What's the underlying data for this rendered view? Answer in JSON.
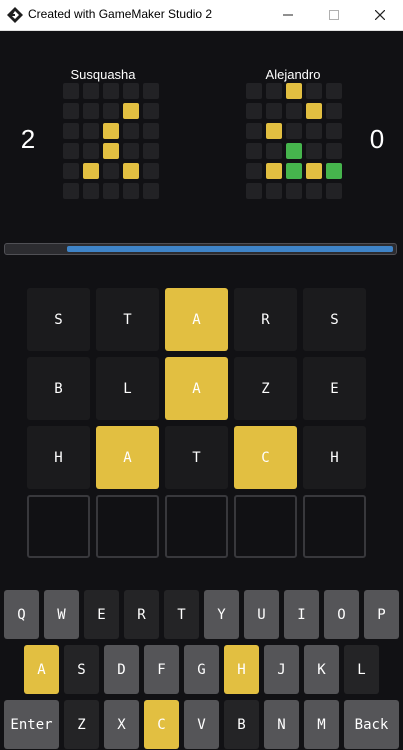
{
  "window": {
    "title": "Created with GameMaker Studio 2"
  },
  "colors": {
    "yellow": "#e2bf41",
    "green": "#46b54d",
    "tile_dark": "#1b1b1d",
    "key_default": "#555558",
    "key_absent": "#242426",
    "mini_empty": "#222225",
    "progress": "#3f84c8"
  },
  "players": [
    {
      "name": "Susquasha",
      "score": "2",
      "grid": [
        [
          "e",
          "e",
          "e",
          "e",
          "e"
        ],
        [
          "e",
          "e",
          "e",
          "y",
          "e"
        ],
        [
          "e",
          "e",
          "y",
          "e",
          "e"
        ],
        [
          "e",
          "e",
          "y",
          "e",
          "e"
        ],
        [
          "e",
          "y",
          "e",
          "y",
          "e"
        ],
        [
          "e",
          "e",
          "e",
          "e",
          "e"
        ]
      ]
    },
    {
      "name": "Alejandro",
      "score": "0",
      "grid": [
        [
          "e",
          "e",
          "y",
          "e",
          "e"
        ],
        [
          "e",
          "e",
          "e",
          "y",
          "e"
        ],
        [
          "e",
          "y",
          "e",
          "e",
          "e"
        ],
        [
          "e",
          "e",
          "g",
          "e",
          "e"
        ],
        [
          "e",
          "y",
          "g",
          "y",
          "g"
        ],
        [
          "e",
          "e",
          "e",
          "e",
          "e"
        ]
      ]
    }
  ],
  "timer": {
    "remaining_fraction": 0.84
  },
  "board": {
    "rows": [
      [
        {
          "letter": "S",
          "state": "absent"
        },
        {
          "letter": "T",
          "state": "absent"
        },
        {
          "letter": "A",
          "state": "present"
        },
        {
          "letter": "R",
          "state": "absent"
        },
        {
          "letter": "S",
          "state": "absent"
        }
      ],
      [
        {
          "letter": "B",
          "state": "absent"
        },
        {
          "letter": "L",
          "state": "absent"
        },
        {
          "letter": "A",
          "state": "present"
        },
        {
          "letter": "Z",
          "state": "absent"
        },
        {
          "letter": "E",
          "state": "absent"
        }
      ],
      [
        {
          "letter": "H",
          "state": "absent"
        },
        {
          "letter": "A",
          "state": "present"
        },
        {
          "letter": "T",
          "state": "absent"
        },
        {
          "letter": "C",
          "state": "present"
        },
        {
          "letter": "H",
          "state": "absent"
        }
      ],
      [
        {
          "letter": "",
          "state": "empty"
        },
        {
          "letter": "",
          "state": "empty"
        },
        {
          "letter": "",
          "state": "empty"
        },
        {
          "letter": "",
          "state": "empty"
        },
        {
          "letter": "",
          "state": "empty"
        }
      ]
    ]
  },
  "keyboard": {
    "rows": [
      [
        {
          "label": "Q",
          "state": "default"
        },
        {
          "label": "W",
          "state": "default"
        },
        {
          "label": "E",
          "state": "absent"
        },
        {
          "label": "R",
          "state": "absent"
        },
        {
          "label": "T",
          "state": "absent"
        },
        {
          "label": "Y",
          "state": "default"
        },
        {
          "label": "U",
          "state": "default"
        },
        {
          "label": "I",
          "state": "default"
        },
        {
          "label": "O",
          "state": "default"
        },
        {
          "label": "P",
          "state": "default"
        }
      ],
      [
        {
          "label": "A",
          "state": "present"
        },
        {
          "label": "S",
          "state": "absent"
        },
        {
          "label": "D",
          "state": "default"
        },
        {
          "label": "F",
          "state": "default"
        },
        {
          "label": "G",
          "state": "default"
        },
        {
          "label": "H",
          "state": "present"
        },
        {
          "label": "J",
          "state": "default"
        },
        {
          "label": "K",
          "state": "default"
        },
        {
          "label": "L",
          "state": "absent"
        }
      ],
      [
        {
          "label": "Enter",
          "state": "default",
          "wide": true
        },
        {
          "label": "Z",
          "state": "absent"
        },
        {
          "label": "X",
          "state": "default"
        },
        {
          "label": "C",
          "state": "present"
        },
        {
          "label": "V",
          "state": "default"
        },
        {
          "label": "B",
          "state": "absent"
        },
        {
          "label": "N",
          "state": "default"
        },
        {
          "label": "M",
          "state": "default"
        },
        {
          "label": "Back",
          "state": "default",
          "wide": true
        }
      ]
    ]
  }
}
